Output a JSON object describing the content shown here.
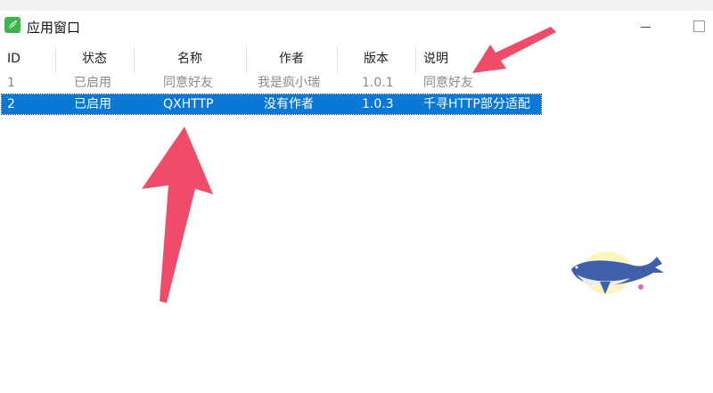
{
  "window": {
    "title": "应用窗口"
  },
  "table": {
    "columns": [
      "ID",
      "状态",
      "名称",
      "作者",
      "版本",
      "说明"
    ],
    "rows": [
      {
        "id": "1",
        "status": "已启用",
        "name": "同意好友",
        "author": "我是疯小瑞",
        "version": "1.0.1",
        "description": "同意好友",
        "selected": false
      },
      {
        "id": "2",
        "status": "已启用",
        "name": "QXHTTP",
        "author": "没有作者",
        "version": "1.0.3",
        "description": "千寻HTTP部分适配",
        "selected": true
      }
    ]
  },
  "colors": {
    "selection": "#0a78d7",
    "arrow": "#f04b68",
    "app_icon": "#3bb54a"
  },
  "icons": {
    "app": "leaf-icon",
    "decoration": "whale-icon"
  }
}
